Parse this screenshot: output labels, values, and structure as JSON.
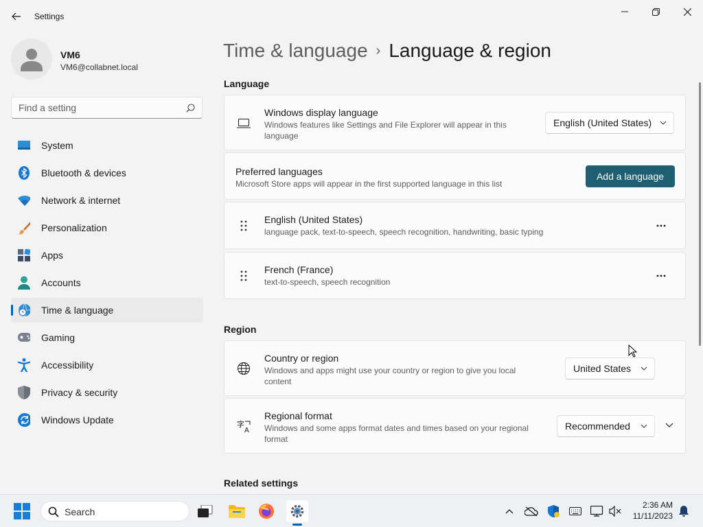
{
  "window": {
    "title": "Settings"
  },
  "profile": {
    "name": "VM6",
    "email": "VM6@collabnet.local"
  },
  "search": {
    "placeholder": "Find a setting"
  },
  "sidebar": {
    "items": [
      {
        "label": "System",
        "icon": "system-icon"
      },
      {
        "label": "Bluetooth & devices",
        "icon": "bluetooth-icon"
      },
      {
        "label": "Network & internet",
        "icon": "wifi-icon"
      },
      {
        "label": "Personalization",
        "icon": "brush-icon"
      },
      {
        "label": "Apps",
        "icon": "apps-icon"
      },
      {
        "label": "Accounts",
        "icon": "person-icon"
      },
      {
        "label": "Time & language",
        "icon": "globe-clock-icon",
        "active": true
      },
      {
        "label": "Gaming",
        "icon": "gamepad-icon"
      },
      {
        "label": "Accessibility",
        "icon": "accessibility-icon"
      },
      {
        "label": "Privacy & security",
        "icon": "shield-icon"
      },
      {
        "label": "Windows Update",
        "icon": "update-icon"
      }
    ]
  },
  "breadcrumb": {
    "parent": "Time & language",
    "separator": "›",
    "current": "Language & region"
  },
  "language": {
    "section_title": "Language",
    "display": {
      "title": "Windows display language",
      "desc": "Windows features like Settings and File Explorer will appear in this language",
      "value": "English (United States)"
    },
    "preferred": {
      "title": "Preferred languages",
      "desc": "Microsoft Store apps will appear in the first supported language in this list",
      "add_button": "Add a language"
    },
    "items": [
      {
        "title": "English (United States)",
        "desc": "language pack, text-to-speech, speech recognition, handwriting, basic typing"
      },
      {
        "title": "French (France)",
        "desc": "text-to-speech, speech recognition"
      }
    ]
  },
  "region": {
    "section_title": "Region",
    "country": {
      "title": "Country or region",
      "desc": "Windows and apps might use your country or region to give you local content",
      "value": "United States"
    },
    "format": {
      "title": "Regional format",
      "desc": "Windows and some apps format dates and times based on your regional format",
      "value": "Recommended"
    }
  },
  "related": {
    "section_title": "Related settings"
  },
  "taskbar": {
    "search_label": "Search",
    "time": "2:36 AM",
    "date": "11/11/2023"
  },
  "colors": {
    "accent": "#005fb8",
    "primary_button": "#1f5f73"
  }
}
